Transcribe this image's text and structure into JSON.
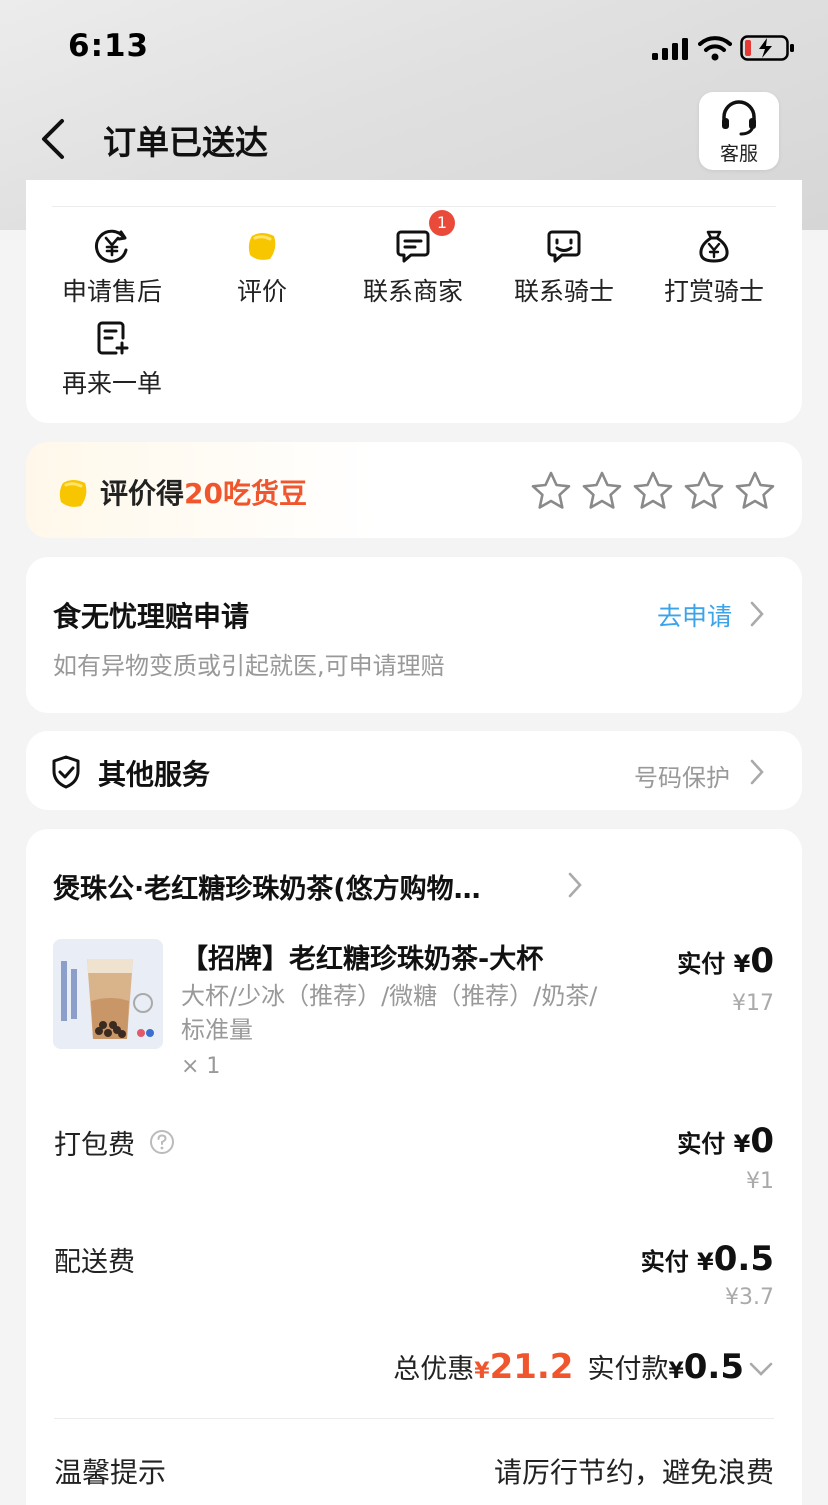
{
  "status_bar": {
    "time": "6:13"
  },
  "nav": {
    "title": "订单已送达",
    "cs_label": "客服"
  },
  "actions": [
    {
      "label": "申请售后",
      "icon": "yen-circle-icon"
    },
    {
      "label": "评价",
      "icon": "bean-icon"
    },
    {
      "label": "联系商家",
      "icon": "chat-icon",
      "badge": "1"
    },
    {
      "label": "联系骑士",
      "icon": "chat-icon"
    },
    {
      "label": "打赏骑士",
      "icon": "money-bag-icon"
    },
    {
      "label": "再来一单",
      "icon": "reorder-icon"
    }
  ],
  "rating": {
    "prefix": "评价得",
    "highlight": "20吃货豆",
    "stars": 5,
    "highlight_color": "#f0562e"
  },
  "claim": {
    "title": "食无忧理赔申请",
    "link": "去申请",
    "subtitle": "如有异物变质或引起就医,可申请理赔",
    "link_color": "#3aa3ea"
  },
  "other_services": {
    "title": "其他服务",
    "right": "号码保护"
  },
  "order": {
    "shop": "煲珠公·老红糖珍珠奶茶(悠方购物…",
    "product": {
      "name": "【招牌】老红糖珍珠奶茶-大杯",
      "spec": "大杯/少冰（推荐）/微糖（推荐）/奶茶/标准量",
      "qty": "× 1",
      "paid_label": "实付 ¥",
      "paid": "0",
      "original": "¥17"
    },
    "packing": {
      "label": "打包费",
      "paid_label": "实付 ¥",
      "paid": "0",
      "original": "¥1"
    },
    "delivery": {
      "label": "配送费",
      "paid_label": "实付 ¥",
      "paid": "0.5",
      "original": "¥3.7"
    },
    "summary": {
      "discount_label": "总优惠",
      "discount_symbol": "¥",
      "discount": "21.2",
      "paid_label": "实付款",
      "paid_symbol": "¥",
      "paid": "0.5"
    },
    "tip": {
      "label": "温馨提示",
      "text": "请厉行节约，避免浪费"
    }
  }
}
